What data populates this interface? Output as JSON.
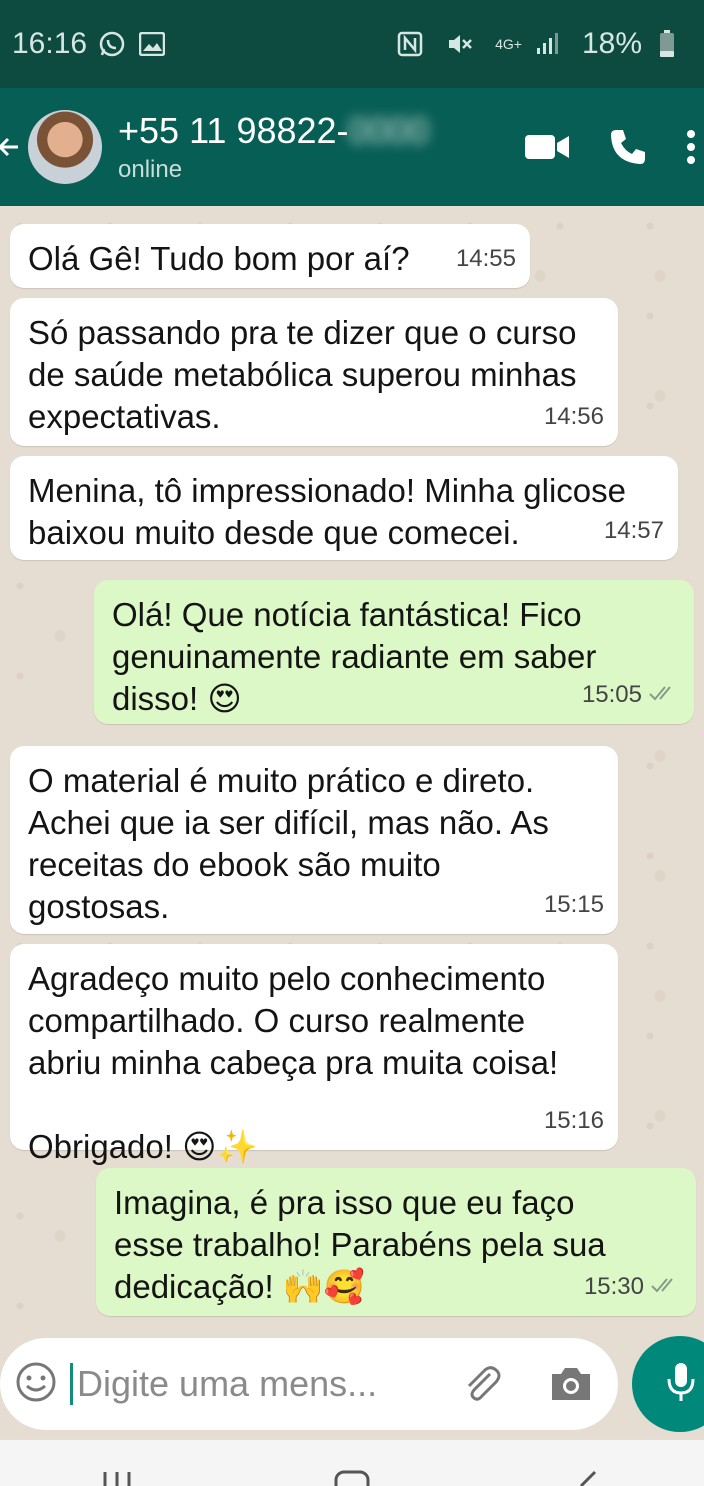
{
  "status_bar": {
    "time": "16:16",
    "network": "4G+",
    "battery": "18%",
    "icons": [
      "whatsapp-icon",
      "image-icon",
      "nfc-icon",
      "mute-icon",
      "signal-icon",
      "battery-icon"
    ]
  },
  "header": {
    "number_visible": "+55 11 98822-",
    "number_hidden": "0000",
    "status": "online",
    "icons": [
      "back-arrow-icon",
      "video-call-icon",
      "phone-icon",
      "more-vert-icon"
    ]
  },
  "messages": [
    {
      "dir": "in",
      "text": "Olá Gê! Tudo bom por aí?",
      "time": "14:55"
    },
    {
      "dir": "in",
      "text": "Só passando pra te dizer que o curso\nde saúde metabólica superou minhas\nexpectativas.",
      "time": "14:56"
    },
    {
      "dir": "in",
      "text": "Menina, tô impressionado! Minha glicose\nbaixou muito desde que comecei.",
      "time": "14:57"
    },
    {
      "dir": "out",
      "text": "Olá! Que notícia fantástica! Fico\ngenuinamente radiante em saber\ndisso! 😍",
      "time": "15:05",
      "read": true
    },
    {
      "dir": "in",
      "text": "O material é muito prático e direto.\nAchei que ia ser difícil, mas não. As\nreceitas do ebook são muito\ngostosas.",
      "time": "15:15"
    },
    {
      "dir": "in",
      "text": "Agradeço muito pelo conhecimento\ncompartilhado. O curso realmente\nabriu minha cabeça pra muita coisa!\n\nObrigado! 😍✨",
      "time": "15:16"
    },
    {
      "dir": "out",
      "text": "Imagina, é pra isso que eu faço\nesse trabalho! Parabéns pela sua\ndedicação! 🙌🥰",
      "time": "15:30",
      "read": true
    }
  ],
  "composer": {
    "placeholder": "Digite uma mens...",
    "icons": [
      "emoji-icon",
      "attach-icon",
      "camera-icon",
      "mic-icon"
    ]
  },
  "colors": {
    "header": "#075e54",
    "status_bar": "#0d4b40",
    "incoming_bubble": "#ffffff",
    "outgoing_bubble": "#dcf8c6",
    "mic_button": "#00897b"
  }
}
